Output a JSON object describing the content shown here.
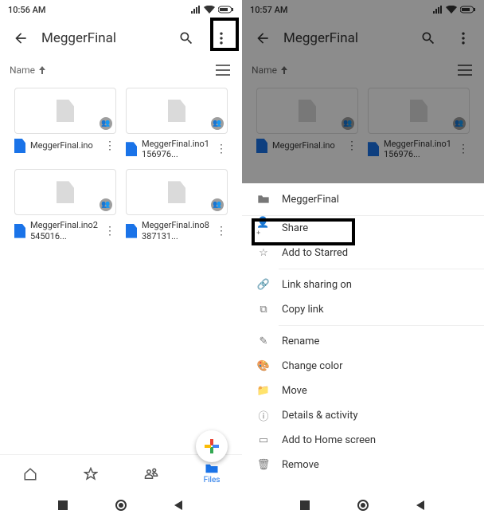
{
  "left": {
    "time": "10:56 AM",
    "breadcrumb": "MeggerFinal",
    "sort_label": "Name",
    "files": [
      {
        "name": "MeggerFinal.ino"
      },
      {
        "name": "MeggerFinal.ino1156976..."
      },
      {
        "name": "MeggerFinal.ino2545016..."
      },
      {
        "name": "MeggerFinal.ino8387131..."
      }
    ],
    "nav": {
      "files": "Files"
    }
  },
  "right": {
    "time": "10:57 AM",
    "breadcrumb": "MeggerFinal",
    "sort_label": "Name",
    "files": [
      {
        "name": "MeggerFinal.ino"
      },
      {
        "name": "MeggerFinal.ino1156976..."
      }
    ],
    "sheet": {
      "title": "MeggerFinal",
      "items": {
        "share": "Share",
        "star": "Add to Starred",
        "link": "Link sharing on",
        "copy": "Copy link",
        "rename": "Rename",
        "color": "Change color",
        "move": "Move",
        "details": "Details & activity",
        "home": "Add to Home screen",
        "remove": "Remove"
      }
    }
  }
}
